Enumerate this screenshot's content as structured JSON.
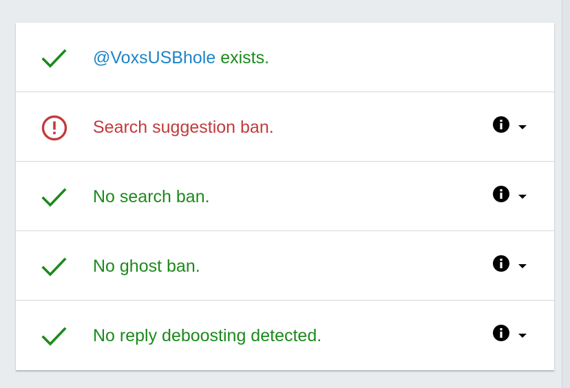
{
  "colors": {
    "ok": "#1b8a1b",
    "warn": "#c23b3b",
    "link": "#1d84c6",
    "background": "#e8ecef"
  },
  "results": [
    {
      "status": "ok",
      "status_icon": "check-icon",
      "handle": "@VoxsUSBhole",
      "text": " exists.",
      "has_actions": false
    },
    {
      "status": "warn",
      "status_icon": "alert-circle-icon",
      "text": "Search suggestion ban.",
      "has_actions": true
    },
    {
      "status": "ok",
      "status_icon": "check-icon",
      "text": "No search ban.",
      "has_actions": true
    },
    {
      "status": "ok",
      "status_icon": "check-icon",
      "text": "No ghost ban.",
      "has_actions": true
    },
    {
      "status": "ok",
      "status_icon": "check-icon",
      "text": "No reply deboosting detected.",
      "has_actions": true
    }
  ]
}
